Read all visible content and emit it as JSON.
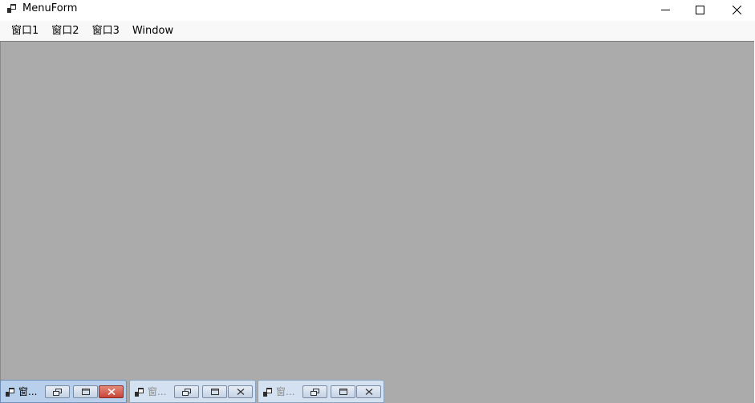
{
  "window": {
    "title": "MenuForm"
  },
  "menubar": {
    "items": [
      {
        "label": "窗口1"
      },
      {
        "label": "窗口2"
      },
      {
        "label": "窗口3"
      },
      {
        "label": "Window"
      }
    ]
  },
  "mdi": {
    "minimized_children": [
      {
        "title": "窗...",
        "state": "active"
      },
      {
        "title": "窗...",
        "state": "inactive"
      },
      {
        "title": "窗...",
        "state": "inactive"
      }
    ]
  },
  "colors": {
    "client_background": "#ababab",
    "menubar_background": "#f8f8f8",
    "active_close": "#c7463a"
  },
  "icons": [
    "app-icon",
    "minimize-icon",
    "maximize-icon",
    "close-icon",
    "restore-icon"
  ]
}
